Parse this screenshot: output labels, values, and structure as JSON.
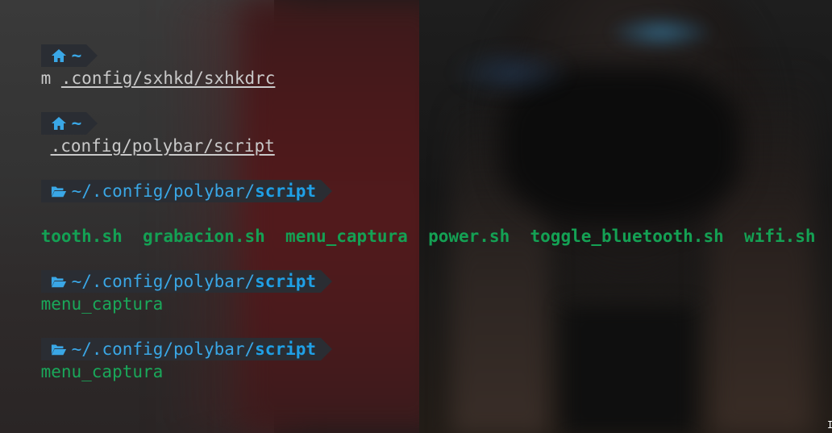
{
  "theme": {
    "prompt_bg": "#2a2d33",
    "accent_blue": "#3aa7e6",
    "dir_green": "#14a154",
    "text": "#c9c9c9"
  },
  "lines": [
    {
      "prompt_icon": "home-icon",
      "prompt_path": "~"
    },
    {
      "cmd_prefix": "m",
      "cmd_arg": ".config/sxhkd/sxhkdrc"
    },
    {
      "prompt_icon": "home-icon",
      "prompt_path": "~"
    },
    {
      "cmd_arg": ".config/polybar/script"
    },
    {
      "prompt_icon": "folder-open-icon",
      "prompt_path_prefix": "~/.config/polybar/",
      "prompt_path_current": "script"
    },
    {
      "ls_items": [
        "tooth.sh",
        "grabacion.sh",
        "menu_captura",
        "power.sh",
        "toggle_bluetooth.sh",
        "wifi.sh"
      ]
    },
    {
      "prompt_icon": "folder-open-icon",
      "prompt_path_prefix": "~/.config/polybar/",
      "prompt_path_current": "script"
    },
    {
      "output": "menu_captura"
    },
    {
      "prompt_icon": "folder-open-icon",
      "prompt_path_prefix": "~/.config/polybar/",
      "prompt_path_current": "script"
    },
    {
      "output": "menu_captura"
    }
  ]
}
